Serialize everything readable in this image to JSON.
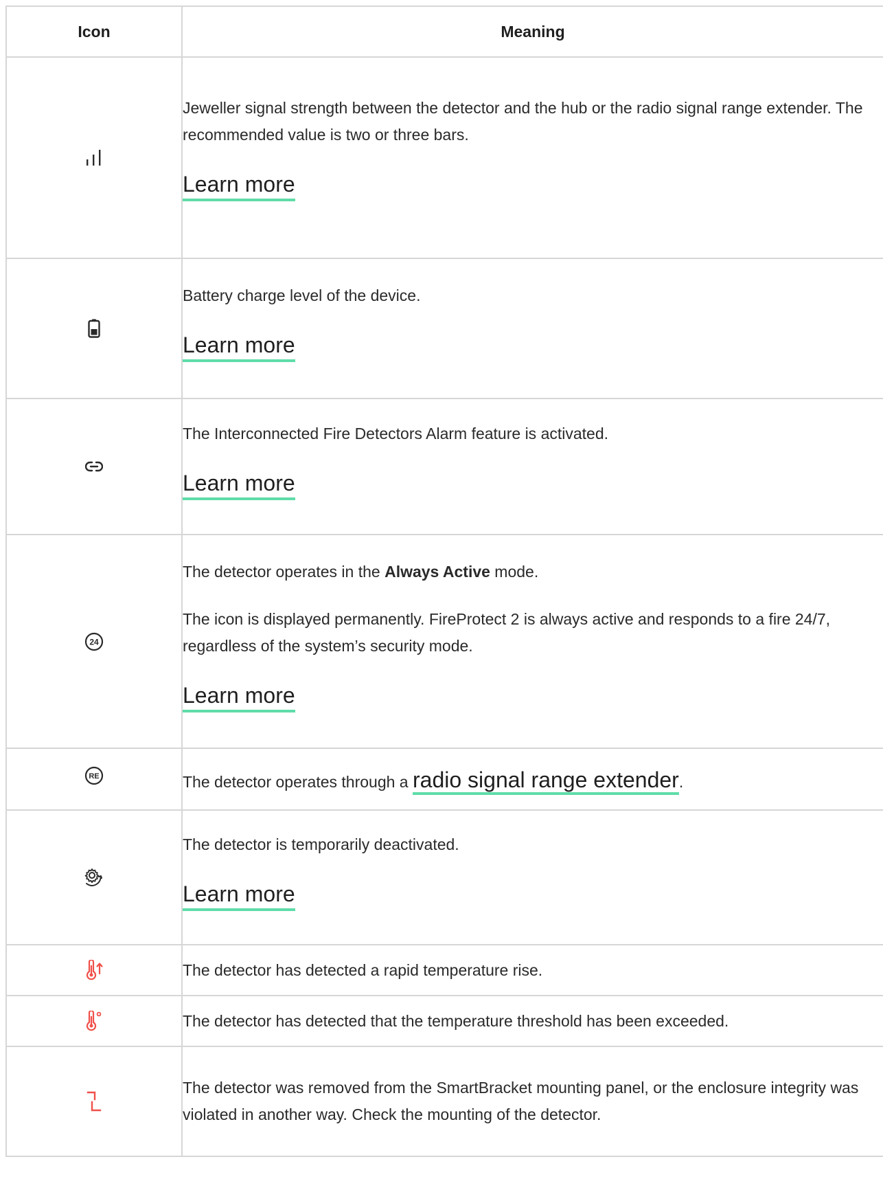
{
  "table": {
    "header_icon": "Icon",
    "header_meaning": "Meaning"
  },
  "rows": [
    {
      "icon": "signal-strength-icon",
      "text": "Jeweller signal strength between the detector and the hub or the radio signal range extender. The recommended value is two or three bars.",
      "link": "Learn more"
    },
    {
      "icon": "battery-icon",
      "text": "Battery charge level of the device.",
      "link": "Learn more"
    },
    {
      "icon": "link-icon",
      "text": "The Interconnected Fire Detectors Alarm feature is activated.",
      "link": "Learn more"
    },
    {
      "icon": "always-active-24-icon",
      "text_before": "The detector operates in the ",
      "text_bold": "Always Active",
      "text_after": " mode.",
      "text2": "The icon is displayed permanently. FireProtect 2 is always active and responds to a fire 24/7, regardless of the system’s security mode.",
      "link": "Learn more",
      "badge": "24"
    },
    {
      "icon": "range-extender-icon",
      "text_before": "The detector operates through a ",
      "link": "radio signal range extender",
      "text_after": ".",
      "badge": "RE"
    },
    {
      "icon": "gear-deactivated-icon",
      "text": "The detector is temporarily deactivated.",
      "link": "Learn more"
    },
    {
      "icon": "thermometer-rise-icon",
      "text": "The detector has detected a rapid temperature rise."
    },
    {
      "icon": "thermometer-threshold-icon",
      "text": "The detector has detected that the temperature threshold has been exceeded."
    },
    {
      "icon": "tamper-icon",
      "text": "The detector was removed from the SmartBracket mounting panel, or the enclosure integrity was violated in another way. Check the mounting of the detector."
    }
  ],
  "colors": {
    "accent_underline": "#5fdca8",
    "alert_red": "#f0504a",
    "border": "#d6d6d6"
  }
}
